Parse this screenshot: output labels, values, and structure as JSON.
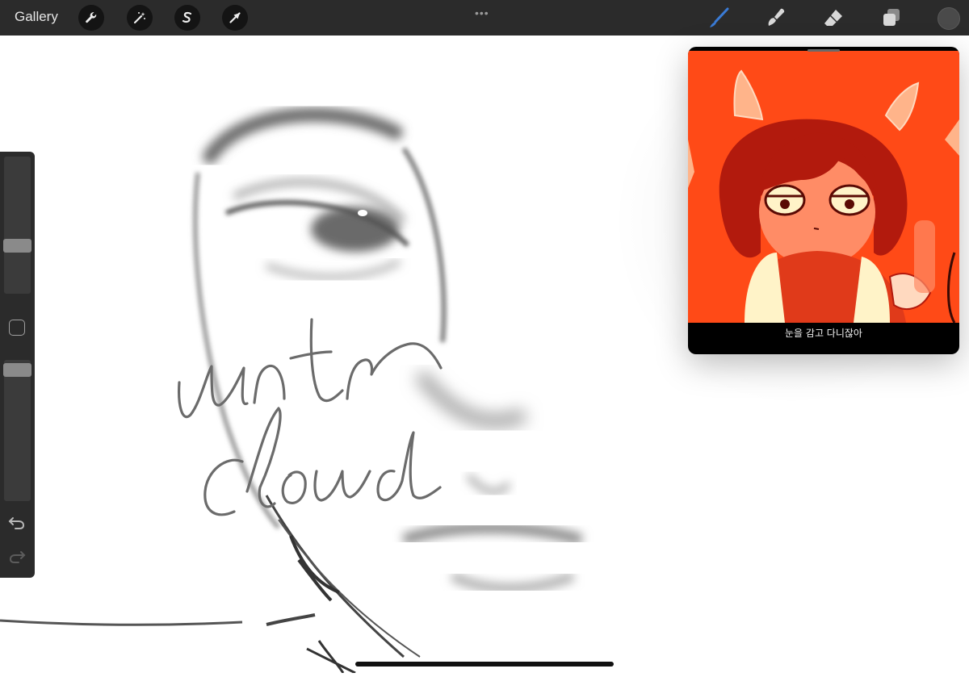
{
  "toolbar": {
    "gallery_label": "Gallery",
    "left_tools": [
      "wrench-icon",
      "magic-wand-icon",
      "selection-s-icon",
      "transform-arrow-icon"
    ],
    "more_label": "•••",
    "right_tools": [
      "brush-icon",
      "smudge-icon",
      "eraser-icon",
      "layers-icon",
      "color-swatch"
    ],
    "accent_color": "#3a7bd5",
    "active_color": "#4a4a4a"
  },
  "sidebar": {
    "size_slider_level": 0.62,
    "opacity_slider_level": 0.93,
    "modify_button": "square-icon",
    "undo": "undo-icon",
    "redo": "redo-icon"
  },
  "canvas": {
    "handwriting_line1": "untr",
    "handwriting_line2": "cloud"
  },
  "pip": {
    "caption": "눈을 감고 다니잖아",
    "background_color": "#ff4a17"
  }
}
